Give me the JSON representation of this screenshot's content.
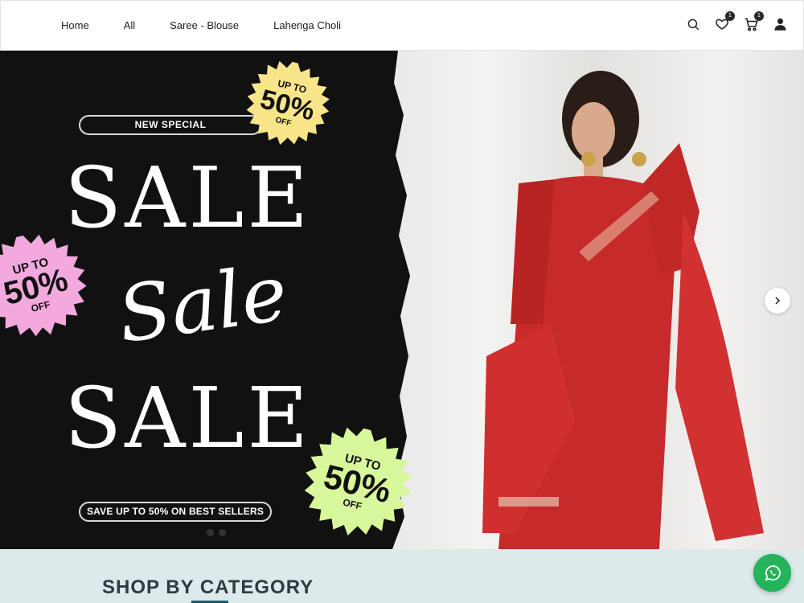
{
  "nav": {
    "items": [
      {
        "label": "Home"
      },
      {
        "label": "All"
      },
      {
        "label": "Saree - Blouse"
      },
      {
        "label": "Lahenga Choli"
      }
    ]
  },
  "header_icons": {
    "search": "search-icon",
    "wishlist": "heart-icon",
    "wishlist_count": "1",
    "cart": "cart-icon",
    "cart_count": "1",
    "account": "user-icon"
  },
  "hero": {
    "tag": "NEW SPECIAL",
    "headline_top": "SALE",
    "headline_script": "Sale",
    "headline_bottom": "SALE",
    "cta": "SAVE UP TO 50% ON BEST SELLERS",
    "badges": [
      {
        "line1": "UP TO",
        "value": "50%",
        "line3": "OFF",
        "color": "#f9e589"
      },
      {
        "line1": "UP TO",
        "value": "50%",
        "line3": "OFF",
        "color": "#f3a9dd"
      },
      {
        "line1": "UP TO",
        "value": "50%",
        "line3": "OFF",
        "color": "#d8f69a"
      }
    ],
    "slide_count": 3,
    "active_slide": 1,
    "next_icon": "chevron-right-icon"
  },
  "category": {
    "title": "SHOP BY CATEGORY"
  },
  "whatsapp": {
    "icon": "whatsapp-icon"
  },
  "colors": {
    "hero_dark": "#111111",
    "accent": "#1b5d6b",
    "whatsapp": "#25b35b",
    "section_bg": "#dde9ea"
  }
}
